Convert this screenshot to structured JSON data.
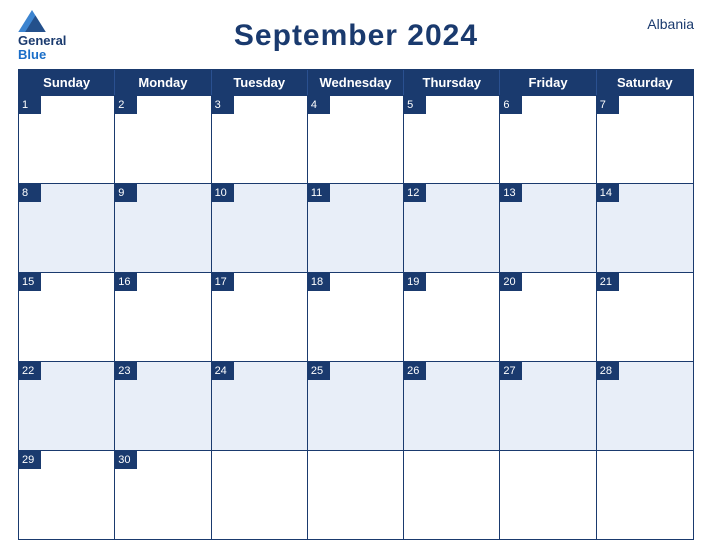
{
  "header": {
    "logo_general": "General",
    "logo_blue": "Blue",
    "title": "September 2024",
    "country": "Albania"
  },
  "days_of_week": [
    "Sunday",
    "Monday",
    "Tuesday",
    "Wednesday",
    "Thursday",
    "Friday",
    "Saturday"
  ],
  "weeks": [
    [
      {
        "num": "1",
        "empty": false
      },
      {
        "num": "2",
        "empty": false
      },
      {
        "num": "3",
        "empty": false
      },
      {
        "num": "4",
        "empty": false
      },
      {
        "num": "5",
        "empty": false
      },
      {
        "num": "6",
        "empty": false
      },
      {
        "num": "7",
        "empty": false
      }
    ],
    [
      {
        "num": "8",
        "empty": false
      },
      {
        "num": "9",
        "empty": false
      },
      {
        "num": "10",
        "empty": false
      },
      {
        "num": "11",
        "empty": false
      },
      {
        "num": "12",
        "empty": false
      },
      {
        "num": "13",
        "empty": false
      },
      {
        "num": "14",
        "empty": false
      }
    ],
    [
      {
        "num": "15",
        "empty": false
      },
      {
        "num": "16",
        "empty": false
      },
      {
        "num": "17",
        "empty": false
      },
      {
        "num": "18",
        "empty": false
      },
      {
        "num": "19",
        "empty": false
      },
      {
        "num": "20",
        "empty": false
      },
      {
        "num": "21",
        "empty": false
      }
    ],
    [
      {
        "num": "22",
        "empty": false
      },
      {
        "num": "23",
        "empty": false
      },
      {
        "num": "24",
        "empty": false
      },
      {
        "num": "25",
        "empty": false
      },
      {
        "num": "26",
        "empty": false
      },
      {
        "num": "27",
        "empty": false
      },
      {
        "num": "28",
        "empty": false
      }
    ],
    [
      {
        "num": "29",
        "empty": false
      },
      {
        "num": "30",
        "empty": false
      },
      {
        "num": "",
        "empty": true
      },
      {
        "num": "",
        "empty": true
      },
      {
        "num": "",
        "empty": true
      },
      {
        "num": "",
        "empty": true
      },
      {
        "num": "",
        "empty": true
      }
    ]
  ],
  "alt_rows": [
    false,
    true,
    false,
    true,
    false
  ],
  "colors": {
    "header_bg": "#1a3a6e",
    "alt_row_bg": "#e8eef8",
    "white": "#ffffff",
    "text_dark": "#1a3a6e"
  }
}
